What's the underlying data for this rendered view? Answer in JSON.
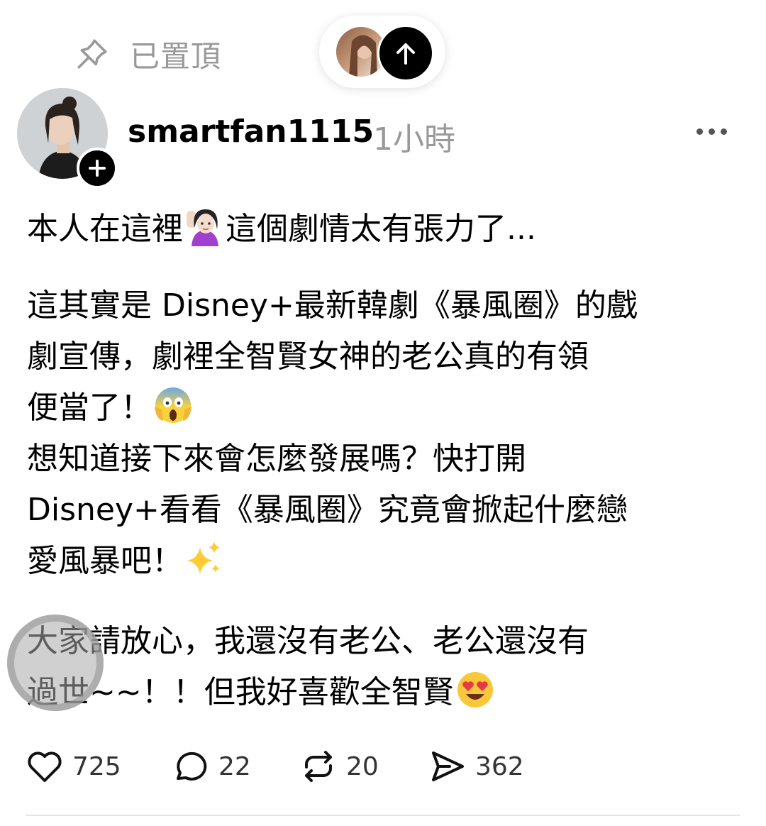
{
  "pinned": {
    "label": "已置頂",
    "icon": "pin-icon"
  },
  "jump_pill": {
    "avatar": "avatar",
    "icon": "arrow-up-icon"
  },
  "post": {
    "username": "smartfan1115",
    "time": "1小時",
    "paragraphs": [
      {
        "text_before": "本人在這裡",
        "emoji": "woman-raising-hand-emoji",
        "text_after": "這個劇情太有張力了..."
      },
      {
        "line1": "這其實是 Disney+最新韓劇《暴風圈》的戲",
        "line2": "劇宣傳，劇裡全智賢女神的老公真的有領",
        "line3": "便當了！",
        "line3_emoji": "face-screaming-in-fear-emoji",
        "line4": "想知道接下來會怎麼發展嗎？快打開",
        "line5": "Disney+看看《暴風圈》究竟會掀起什麼戀",
        "line6": "愛風暴吧！",
        "line6_emoji": "sparkles-emoji"
      },
      {
        "line1": "大家請放心，我還沒有老公、老公還沒有",
        "line2": "過世~~！！但我好喜歡全智賢",
        "line2_emoji": "smiling-face-with-heart-eyes-emoji"
      }
    ]
  },
  "actions": {
    "likes": "725",
    "comments": "22",
    "reposts": "20",
    "shares": "362"
  },
  "colors": {
    "secondary_text": "#999999",
    "primary_text": "#000000"
  }
}
